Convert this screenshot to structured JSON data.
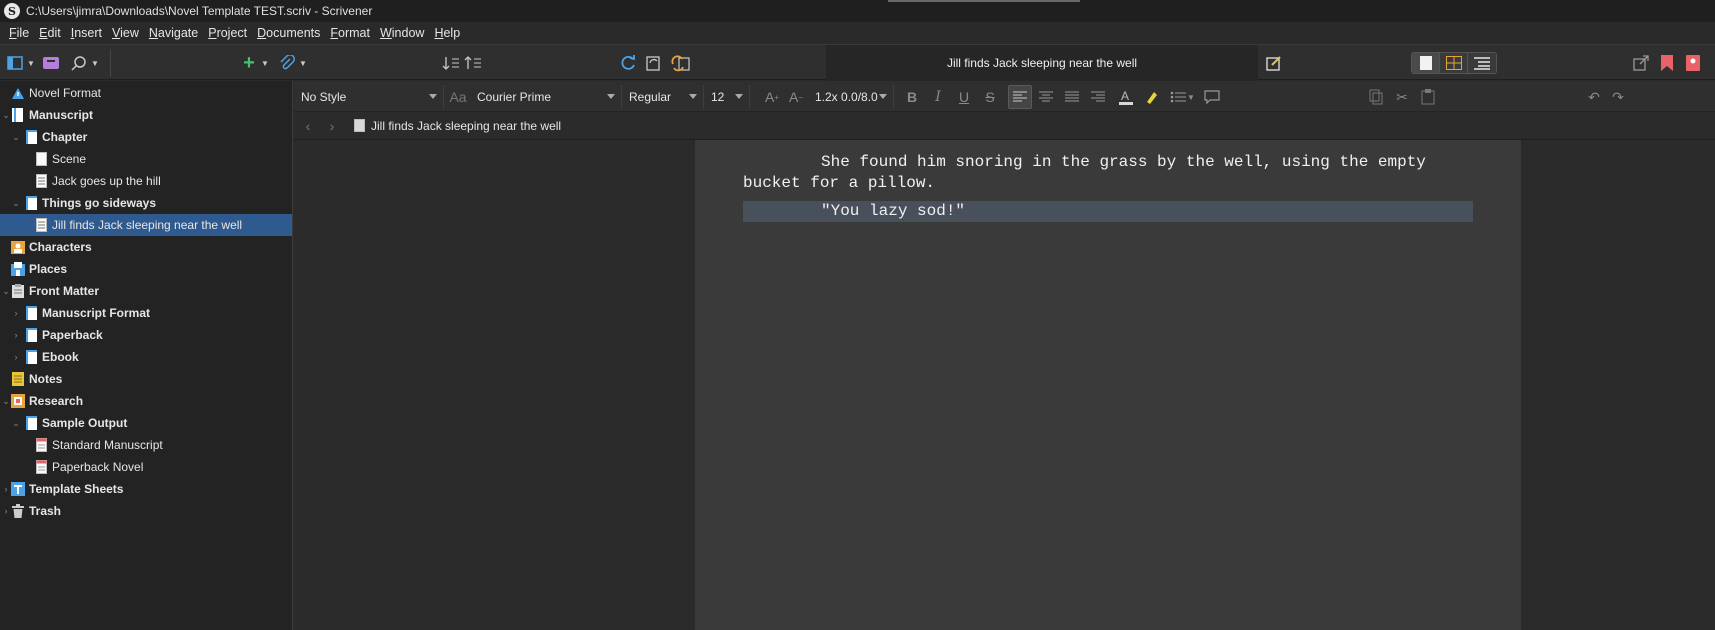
{
  "window": {
    "title": "C:\\Users\\jimra\\Downloads\\Novel Template TEST.scriv - Scrivener",
    "logo_letter": "S"
  },
  "menu": [
    "File",
    "Edit",
    "Insert",
    "View",
    "Navigate",
    "Project",
    "Documents",
    "Format",
    "Window",
    "Help"
  ],
  "toolbar": {
    "document_title": "Jill finds Jack sleeping near the well",
    "icons": [
      "binder-toggle-icon",
      "composition-icon",
      "search-icon",
      "add-icon",
      "attachment-icon",
      "sort-down-icon",
      "sort-up-icon",
      "sync-icon",
      "snapshot-icon",
      "compare-icon",
      "inspector-note-icon",
      "single-view-icon",
      "corkboard-icon",
      "outline-icon",
      "share-icon",
      "bookmark-icon",
      "inspector-icon"
    ]
  },
  "colors": {
    "accent_green": "#3fc46a",
    "accent_blue": "#4aa3e8",
    "accent_orange": "#e8a43a",
    "accent_red": "#e8626a",
    "selection": "#2f5a8f"
  },
  "binder": {
    "items": [
      {
        "label": "Novel Format",
        "icon": "warning-icon",
        "level": 0,
        "bold": false,
        "toggle": ""
      },
      {
        "label": "Manuscript",
        "icon": "manuscript-icon",
        "level": 0,
        "bold": true,
        "toggle": "v"
      },
      {
        "label": "Chapter",
        "icon": "folder-doc-icon",
        "level": 1,
        "bold": true,
        "toggle": "v"
      },
      {
        "label": "Scene",
        "icon": "document-icon",
        "level": 2,
        "bold": false,
        "toggle": ""
      },
      {
        "label": "Jack goes up the hill",
        "icon": "document-text-icon",
        "level": 2,
        "bold": false,
        "toggle": ""
      },
      {
        "label": "Things go sideways",
        "icon": "folder-doc-icon",
        "level": 1,
        "bold": true,
        "toggle": "v"
      },
      {
        "label": "Jill finds Jack sleeping near the well",
        "icon": "document-text-icon",
        "level": 2,
        "bold": false,
        "toggle": "",
        "selected": true
      },
      {
        "label": "Characters",
        "icon": "characters-icon",
        "level": 0,
        "bold": true,
        "toggle": ""
      },
      {
        "label": "Places",
        "icon": "places-icon",
        "level": 0,
        "bold": true,
        "toggle": ""
      },
      {
        "label": "Front Matter",
        "icon": "front-matter-icon",
        "level": 0,
        "bold": true,
        "toggle": "v"
      },
      {
        "label": "Manuscript Format",
        "icon": "folder-doc-icon",
        "level": 1,
        "bold": true,
        "toggle": ">"
      },
      {
        "label": "Paperback",
        "icon": "folder-doc-icon",
        "level": 1,
        "bold": true,
        "toggle": ">"
      },
      {
        "label": "Ebook",
        "icon": "folder-doc-icon",
        "level": 1,
        "bold": true,
        "toggle": ">"
      },
      {
        "label": "Notes",
        "icon": "notes-icon",
        "level": 0,
        "bold": true,
        "toggle": ""
      },
      {
        "label": "Research",
        "icon": "research-icon",
        "level": 0,
        "bold": true,
        "toggle": "v"
      },
      {
        "label": "Sample Output",
        "icon": "folder-doc-icon",
        "level": 1,
        "bold": true,
        "toggle": "v"
      },
      {
        "label": "Standard Manuscript",
        "icon": "pdf-icon",
        "level": 2,
        "bold": false,
        "toggle": ""
      },
      {
        "label": "Paperback Novel",
        "icon": "pdf-icon",
        "level": 2,
        "bold": false,
        "toggle": ""
      },
      {
        "label": "Template Sheets",
        "icon": "template-icon",
        "level": 0,
        "bold": true,
        "toggle": ">"
      },
      {
        "label": "Trash",
        "icon": "trash-icon",
        "level": 0,
        "bold": true,
        "toggle": ">"
      }
    ]
  },
  "formatbar": {
    "style": "No Style",
    "font_family": "Courier Prime",
    "font_weight": "Regular",
    "font_size": "12",
    "line_spacing": "1.2x 0.0/8.0"
  },
  "header": {
    "document_name": "Jill finds Jack sleeping near the well"
  },
  "editor": {
    "paragraphs": [
      "She found him snoring in the grass by the well, using the empty bucket for a pillow.",
      "\"You lazy sod!\""
    ]
  }
}
